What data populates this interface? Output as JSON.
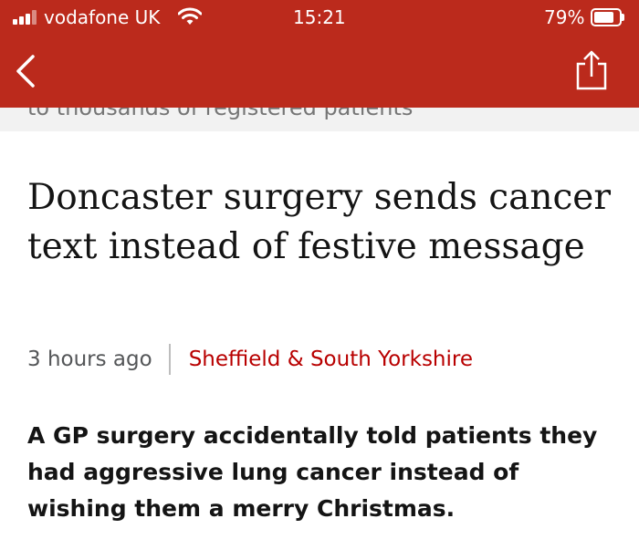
{
  "status_bar": {
    "carrier": "vodafone UK",
    "time": "15:21",
    "battery_percent_label": "79%",
    "battery_level": 0.79
  },
  "nav": {
    "back_icon": "chevron-left-icon",
    "share_icon": "share-icon",
    "brand_color": "#bb2a1c"
  },
  "previous_article_fragment": "to thousands of registered patients",
  "article": {
    "headline": "Doncaster surgery sends cancer text instead of festive message",
    "time_ago": "3 hours ago",
    "section": "Sheffield & South Yorkshire",
    "summary": "A GP surgery accidentally told patients they had aggressive lung cancer instead of wishing them a merry Christmas."
  },
  "colors": {
    "section_link": "#b80000",
    "text": "#141414"
  }
}
